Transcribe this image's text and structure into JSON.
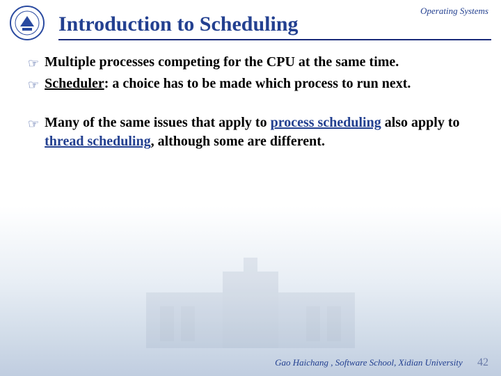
{
  "header": {
    "course_label": "Operating Systems",
    "title": "Introduction to Scheduling"
  },
  "bullets": {
    "b1": "Multiple processes competing for the CPU at the same time.",
    "b2_term": "Scheduler",
    "b2_rest": ": a choice has to be made which process to run next.",
    "b3_a": "Many of the same issues that apply to ",
    "b3_link1": "process scheduling",
    "b3_b": " also apply to ",
    "b3_link2": "thread scheduling",
    "b3_c": ", although some are different."
  },
  "footer": {
    "author": "Gao Haichang , Software School, Xidian University",
    "page": "42"
  },
  "icons": {
    "bullet_glyph": "☞",
    "logo_name": "university-seal"
  }
}
